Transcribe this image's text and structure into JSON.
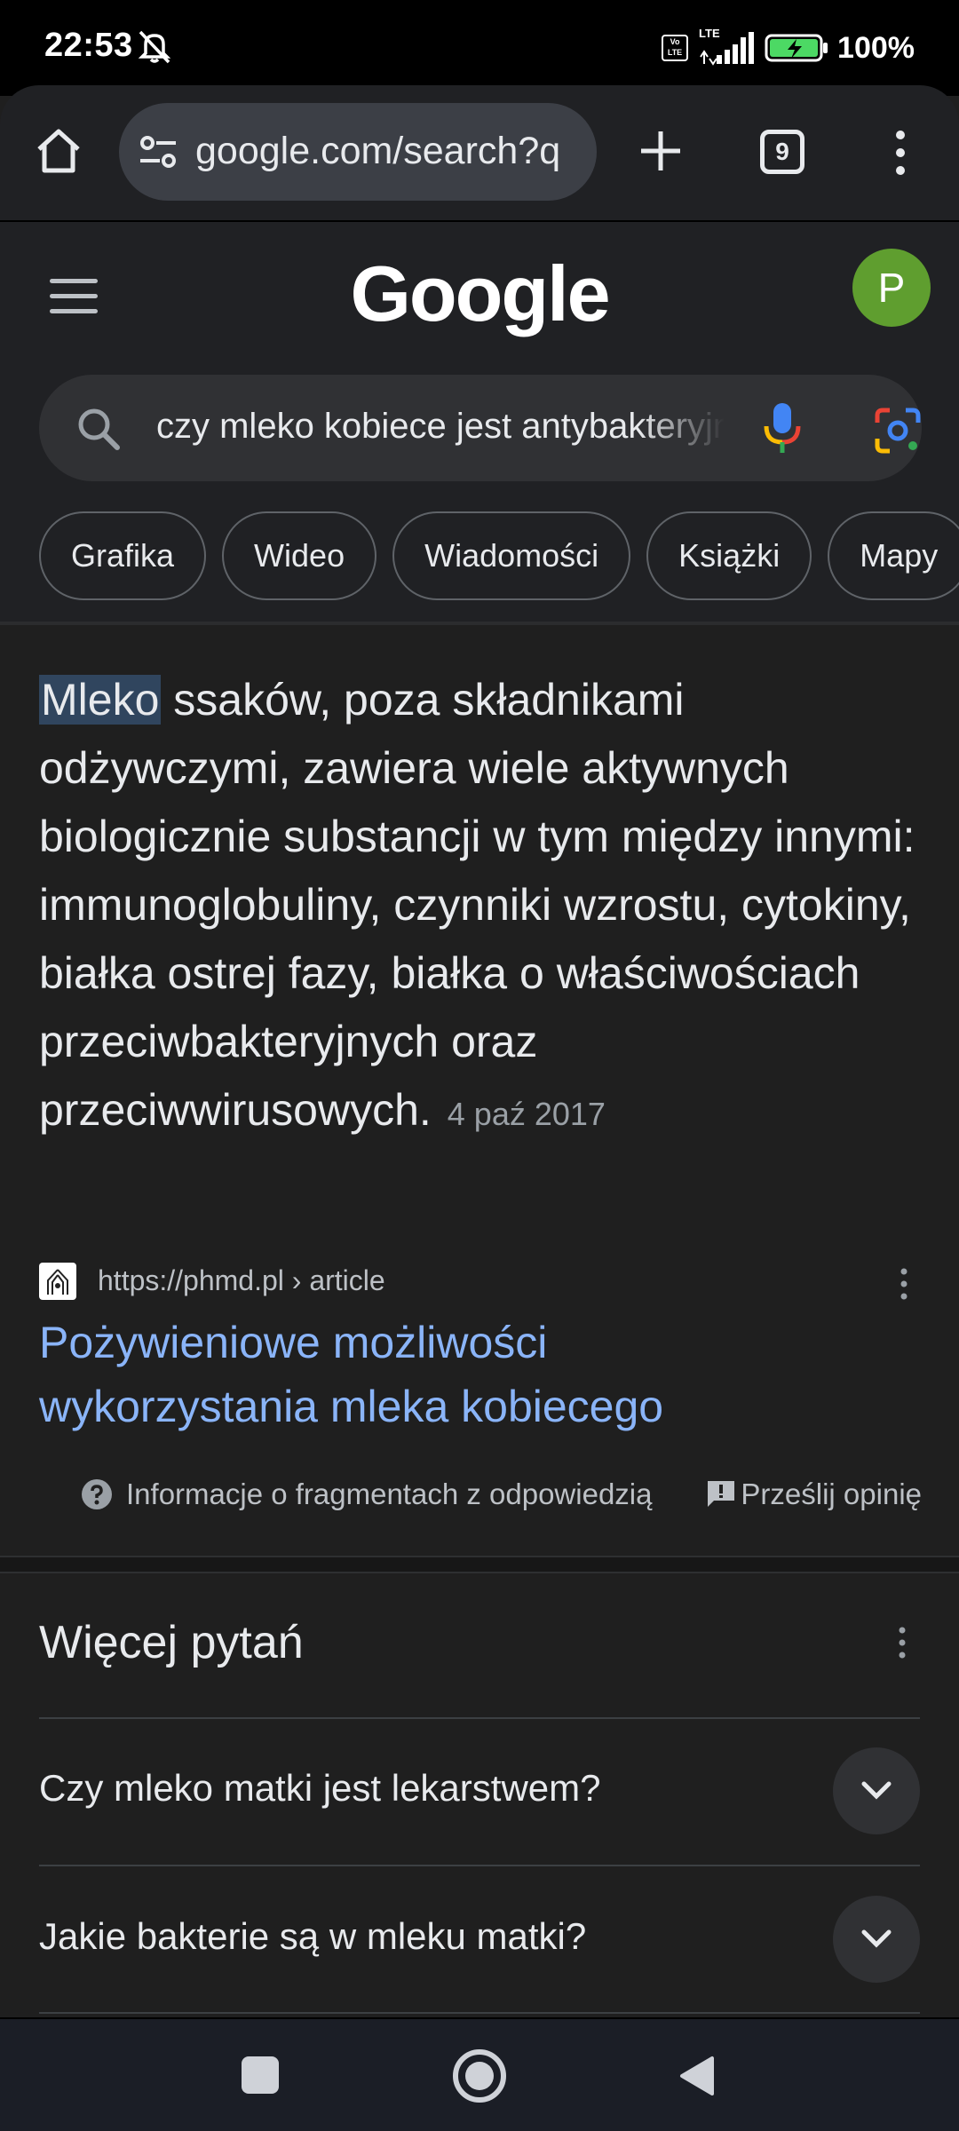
{
  "status_bar": {
    "time": "22:53",
    "volte": "Vo LTE",
    "lte": "LTE",
    "battery": "100%"
  },
  "browser": {
    "url": "google.com/search?q",
    "tab_count": "9"
  },
  "google": {
    "logo": "Google",
    "avatar_letter": "P",
    "search_query": "czy mleko kobiece jest antybakteryjne",
    "chips": [
      "Grafika",
      "Wideo",
      "Wiadomości",
      "Książki",
      "Mapy"
    ]
  },
  "snippet": {
    "highlight": "Mleko",
    "text": " ssaków, poza składnikami odżywczymi, zawiera wiele aktywnych biologicznie substancji w tym między innymi: immunoglobuliny, czynniki wzrostu, cytokiny, białka ostrej fazy, białka o właściwościach przeciwbakteryjnych oraz przeciwwirusowych.",
    "date": "4 paź 2017",
    "source_url": "https://phmd.pl › article",
    "result_title": "Pożywieniowe możliwości wykorzystania mleka kobiecego",
    "about_label": "Informacje o fragmentach z odpowiedzią",
    "feedback_label": "Prześlij opinię"
  },
  "paa": {
    "title": "Więcej pytań",
    "questions": [
      "Czy mleko matki jest lekarstwem?",
      "Jakie bakterie są w mleku matki?"
    ]
  },
  "icons": {
    "status": [
      "mute-icon",
      "volte-icon",
      "signal-icon",
      "battery-charging-icon"
    ],
    "browser": [
      "home-icon",
      "site-settings-icon",
      "plus-icon",
      "tab-switcher-icon",
      "more-vert-icon"
    ],
    "search": [
      "search-icon",
      "mic-icon",
      "google-lens-icon"
    ],
    "nav": [
      "recents-icon",
      "home-icon",
      "back-icon"
    ]
  },
  "colors": {
    "background": "#1f1f1f",
    "link": "#8ab4f8",
    "avatar": "#5f9e2f",
    "highlight": "#30455e"
  }
}
